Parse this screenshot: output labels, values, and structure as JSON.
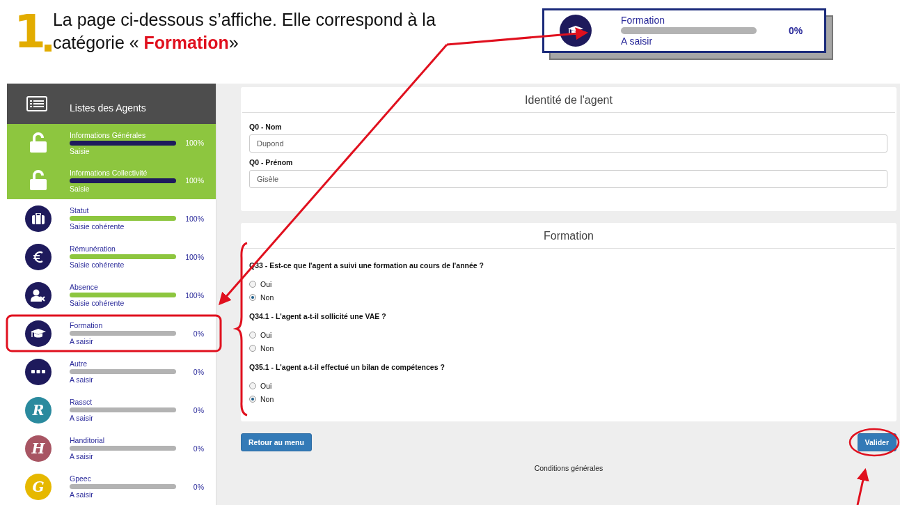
{
  "instruction": {
    "step": "1",
    "text": "La page ci-dessous s’affiche. Elle correspond à la catégorie « **Formation**»"
  },
  "callout": {
    "title": "Formation",
    "level": 0,
    "percent": "0%",
    "status": "A saisir"
  },
  "sidebar": {
    "header": {
      "label": "Listes des Agents"
    },
    "items": [
      {
        "title": "Informations Générales",
        "status": "Saisie",
        "percent": "100%",
        "level": 1,
        "completed": true,
        "kind": "unlock"
      },
      {
        "title": "Informations Collectivité",
        "status": "Saisie",
        "percent": "100%",
        "level": 1,
        "completed": true,
        "kind": "unlock"
      },
      {
        "title": "Statut",
        "status": "Saisie cohérente",
        "percent": "100%",
        "level": 1,
        "completed": false,
        "kind": "briefcase",
        "color": "#1e1a5c"
      },
      {
        "title": "Rémunération",
        "status": "Saisie cohérente",
        "percent": "100%",
        "level": 1,
        "completed": false,
        "kind": "euro",
        "color": "#1e1a5c"
      },
      {
        "title": "Absence",
        "status": "Saisie cohérente",
        "percent": "100%",
        "level": 1,
        "completed": false,
        "kind": "user",
        "color": "#1e1a5c"
      },
      {
        "title": "Formation",
        "status": "A saisir",
        "percent": "0%",
        "level": 0,
        "completed": false,
        "kind": "cap",
        "color": "#1e1a5c"
      },
      {
        "title": "Autre",
        "status": "A saisir",
        "percent": "0%",
        "level": 0,
        "completed": false,
        "kind": "dots",
        "color": "#1e1a5c"
      },
      {
        "title": "Rassct",
        "status": "A saisir",
        "percent": "0%",
        "level": 0,
        "completed": false,
        "kind": "letter",
        "letter": "R",
        "color": "#2a8a9e"
      },
      {
        "title": "Handitorial",
        "status": "A saisir",
        "percent": "0%",
        "level": 0,
        "completed": false,
        "kind": "letter",
        "letter": "H",
        "color": "#a85563"
      },
      {
        "title": "Gpeec",
        "status": "A saisir",
        "percent": "0%",
        "level": 0,
        "completed": false,
        "kind": "letter",
        "letter": "G",
        "color": "#e6b800"
      }
    ]
  },
  "form": {
    "sections": [
      {
        "title": "Identité de l'agent",
        "fields": [
          {
            "label": "Q0 - Nom",
            "value": "Dupond"
          },
          {
            "label": "Q0 - Prénom",
            "value": "Gisèle"
          }
        ]
      },
      {
        "title": "Formation",
        "questions": [
          {
            "label": "Q33 - Est-ce que l'agent a suivi une formation au cours de l'année ?",
            "options": [
              {
                "label": "Oui",
                "selected": false
              },
              {
                "label": "Non",
                "selected": true
              }
            ]
          },
          {
            "label": "Q34.1 - L'agent a-t-il sollicité une VAE ?",
            "options": [
              {
                "label": "Oui",
                "selected": false
              },
              {
                "label": "Non",
                "selected": false
              }
            ]
          },
          {
            "label": "Q35.1 - L'agent a-t-il effectué un bilan de compétences ?",
            "options": [
              {
                "label": "Oui",
                "selected": false
              },
              {
                "label": "Non",
                "selected": true
              }
            ]
          }
        ]
      }
    ],
    "buttons": [
      "Retour au menu",
      "Valider"
    ],
    "footer": "Conditions générales"
  }
}
